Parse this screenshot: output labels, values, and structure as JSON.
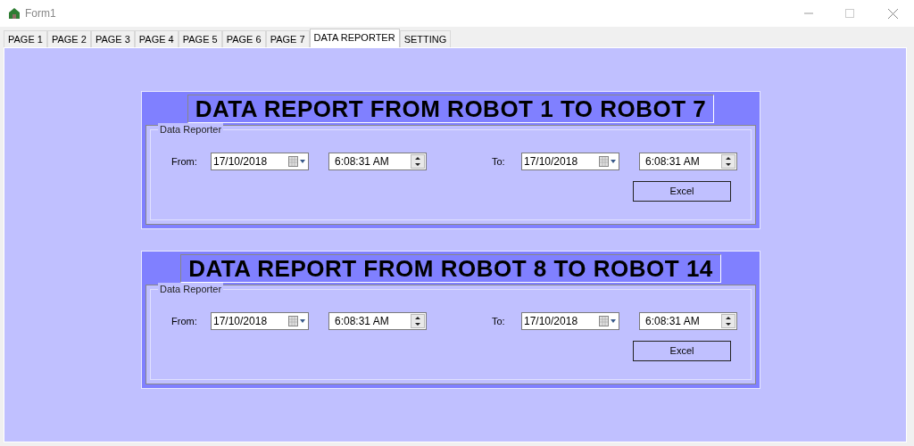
{
  "window": {
    "title": "Form1"
  },
  "tabs": [
    {
      "label": "PAGE 1",
      "selected": false
    },
    {
      "label": "PAGE 2",
      "selected": false
    },
    {
      "label": "PAGE 3",
      "selected": false
    },
    {
      "label": "PAGE 4",
      "selected": false
    },
    {
      "label": "PAGE 5",
      "selected": false
    },
    {
      "label": "PAGE 6",
      "selected": false
    },
    {
      "label": "PAGE 7",
      "selected": false
    },
    {
      "label": "DATA REPORTER",
      "selected": true
    },
    {
      "label": "SETTING",
      "selected": false
    }
  ],
  "reports": [
    {
      "title": "DATA REPORT FROM ROBOT 1 TO ROBOT 7",
      "group": "Data Reporter",
      "from_label": "From:",
      "from_date": "17/10/2018",
      "from_time": "6:08:31 AM",
      "to_label": "To:",
      "to_date": "17/10/2018",
      "to_time": "6:08:31 AM",
      "button": "Excel"
    },
    {
      "title": "DATA REPORT FROM ROBOT 8 TO ROBOT 14",
      "group": "Data Reporter",
      "from_label": "From:",
      "from_date": "17/10/2018",
      "from_time": "6:08:31 AM",
      "to_label": "To:",
      "to_date": "17/10/2018",
      "to_time": "6:08:31 AM",
      "button": "Excel"
    }
  ]
}
